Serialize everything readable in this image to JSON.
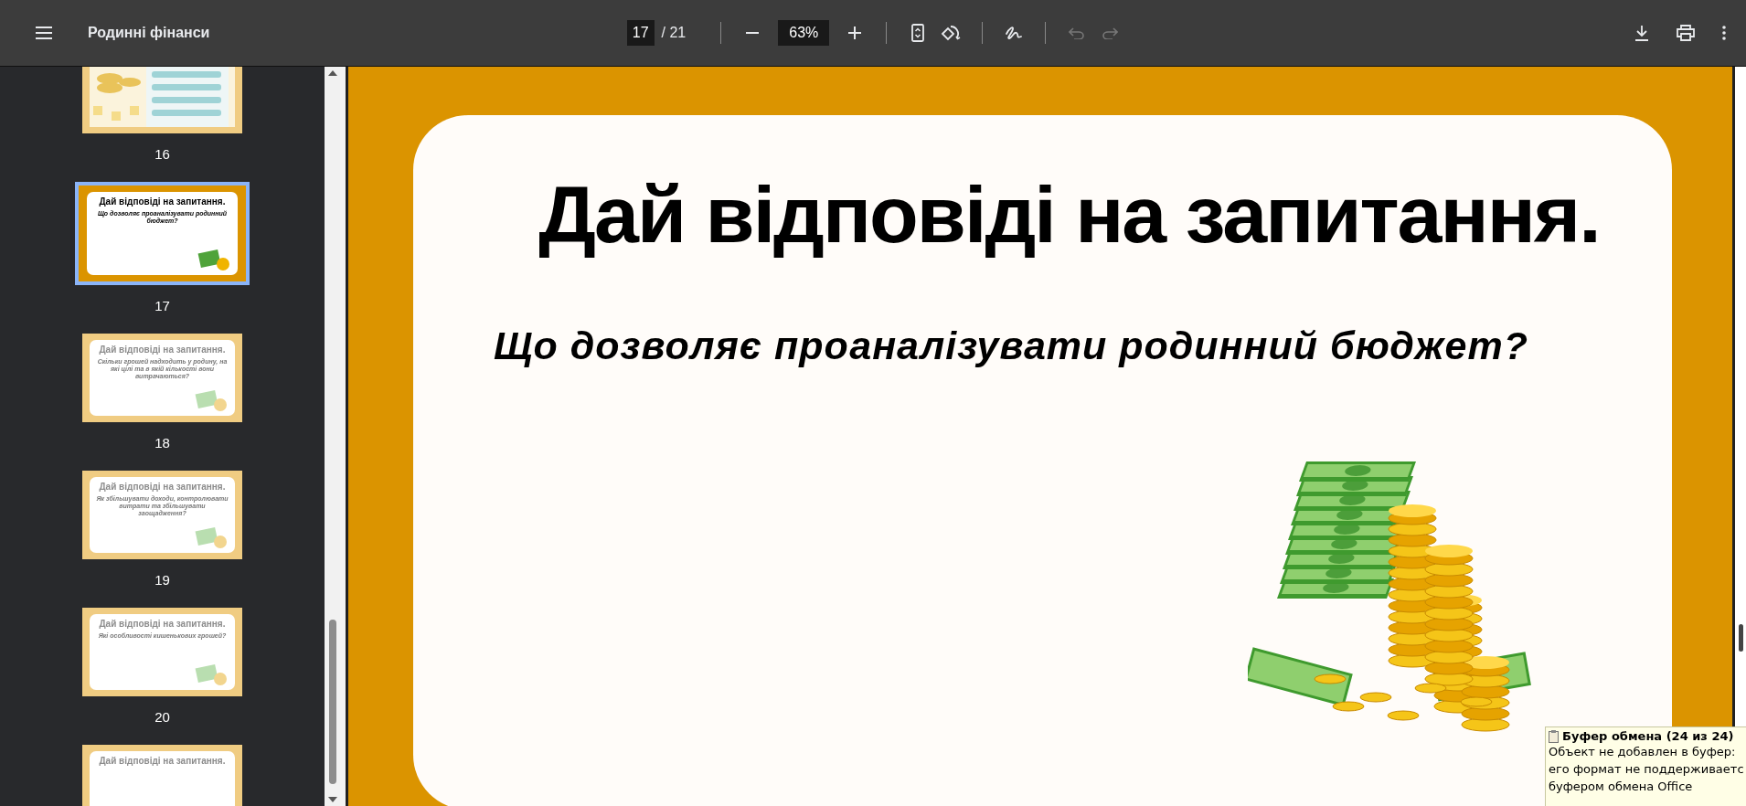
{
  "toolbar": {
    "title": "Родинні фінанси",
    "page": "17",
    "page_count": "/ 21",
    "zoom": "63%",
    "undo_disabled": true,
    "redo_disabled": true
  },
  "thumbnails": [
    {
      "kind": "image",
      "page": "16",
      "selected": false
    },
    {
      "kind": "question",
      "page": "17",
      "selected": true,
      "title": "Дай відповіді на запитання.",
      "question": "Що дозволяє проаналізувати родинний бюджет?"
    },
    {
      "kind": "question",
      "page": "18",
      "selected": false,
      "title": "Дай відповіді на запитання.",
      "question": "Скільки грошей надходить у родину, на які цілі та в якій кількості вони витрачаються?"
    },
    {
      "kind": "question",
      "page": "19",
      "selected": false,
      "title": "Дай відповіді на запитання.",
      "question": "Як збільшувати доходи, контролювати витрати та збільшувати заощадження?"
    },
    {
      "kind": "question",
      "page": "20",
      "selected": false,
      "title": "Дай відповіді на запитання.",
      "question": "Які особливості кишенькових грошей?"
    },
    {
      "kind": "question",
      "selected": false,
      "title": "Дай відповіді на запитання."
    }
  ],
  "slide": {
    "title": "Дай відповіді на запитання.",
    "question": "Що дозволяє проаналізувати родинний бюджет?"
  },
  "clipboard_tooltip": {
    "title": "Буфер обмена (24 из 24)",
    "lines": [
      "Объект не добавлен в буфер:",
      "его формат не поддерживаетс",
      "буфером обмена Office"
    ]
  }
}
